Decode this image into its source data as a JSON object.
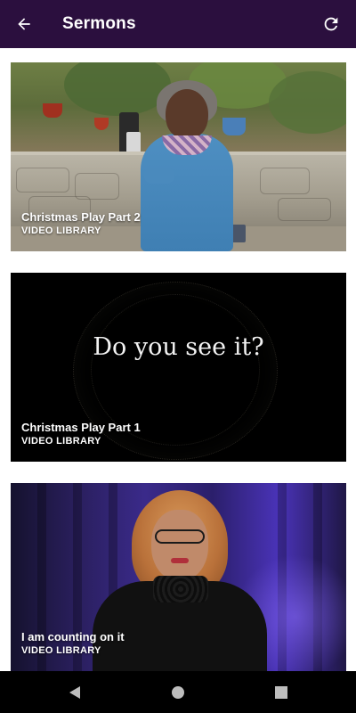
{
  "header": {
    "title": "Sermons",
    "back_icon": "arrow-back-icon",
    "refresh_icon": "refresh-icon",
    "background": "#2b0f3e"
  },
  "videos": [
    {
      "title": "Christmas Play Part 2",
      "subtitle": "VIDEO LIBRARY"
    },
    {
      "title": "Christmas Play Part 1",
      "subtitle": "VIDEO LIBRARY",
      "thumbnail_text": "Do you see it?"
    },
    {
      "title": "I am counting on it",
      "subtitle": "VIDEO LIBRARY"
    }
  ],
  "nav": {
    "back_icon": "nav-back-triangle-icon",
    "home_icon": "nav-home-circle-icon",
    "recents_icon": "nav-recents-square-icon",
    "background": "#000000"
  }
}
